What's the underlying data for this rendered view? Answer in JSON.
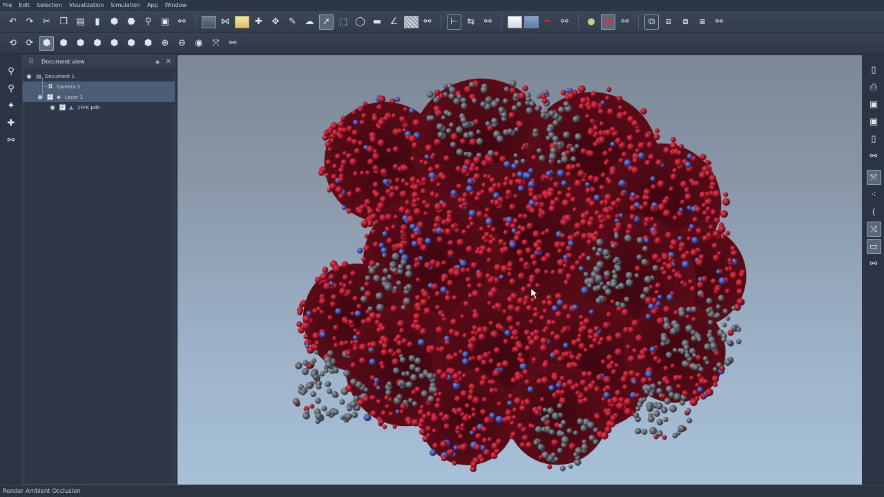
{
  "menu": [
    "File",
    "Edit",
    "Selection",
    "Visualization",
    "Simulation",
    "App",
    "Window"
  ],
  "toolbar1": {
    "group1": [
      "undo-icon",
      "redo-icon",
      "cut-icon",
      "copy-icon",
      "paste-icon",
      "delete-icon",
      "add-hexagon-icon",
      "remove-hexagon-icon",
      "zoom-icon",
      "frame-icon",
      "plugin-icon"
    ],
    "group2": [
      "dark-swatch",
      "bonds-icon",
      "highlight-swatch",
      "add-atom-icon",
      "move-icon",
      "eraser-icon",
      "lasso-icon",
      "select-arrow-icon",
      "select-box-icon",
      "circle-select-icon",
      "ruler-icon",
      "angle-icon",
      "grid-icon",
      "plugin-icon"
    ],
    "group3": [
      "tree-icon",
      "clone-icon",
      "plugin-icon"
    ],
    "group4": [
      "white-swatch",
      "blue-swatch",
      "red-marker-icon",
      "plugin-icon"
    ],
    "group5": [
      "point-icon",
      "target-icon",
      "plugin-icon"
    ],
    "group6": [
      "layout-1-icon",
      "layout-2-icon",
      "layout-3-icon",
      "layout-4-icon",
      "plugin-icon"
    ],
    "active": "select-arrow-icon"
  },
  "toolbar2": [
    "camera-reset-icon",
    "camera-orbit-icon",
    "view-front-icon",
    "view-back-icon",
    "view-left-icon",
    "view-right-icon",
    "view-top-icon",
    "view-bottom-icon",
    "view-iso-icon",
    "zoom-in-icon",
    "zoom-out-icon",
    "visibility-icon",
    "fit-icon",
    "plugin-icon"
  ],
  "left_toolbar": [
    "search-atoms-icon",
    "search-residues-icon",
    "magic-wand-icon",
    "add-structure-icon",
    "plugin-icon"
  ],
  "right_toolbar": [
    "new-document-icon",
    "print-icon",
    "save-icon",
    "save-as-icon",
    "export-icon",
    "plugin-icon",
    "network-icon",
    "nodes-icon",
    "curve-icon",
    "graph-icon",
    "panel-icon",
    "plugin-icon"
  ],
  "document_panel": {
    "title": "Document view",
    "items": [
      {
        "label": "Document 1",
        "icon": "document-icon",
        "level": 0,
        "checked": null,
        "selected": false
      },
      {
        "label": "Camera 1",
        "icon": "camera-icon",
        "level": 1,
        "checked": null,
        "selected": true
      },
      {
        "label": "Layer 1",
        "icon": "layer-icon",
        "level": 1,
        "checked": true,
        "selected": true
      },
      {
        "label": "1FFK.pdb",
        "icon": "molecule-icon",
        "level": 2,
        "checked": true,
        "selected": false
      }
    ]
  },
  "viewport": {
    "subject": "molecular-structure",
    "colors": {
      "background_top": "#7d8796",
      "background_bottom": "#a7c1d9",
      "red": "#b1192e",
      "dark_red": "#5a0c18",
      "blue": "#3a4fa8",
      "grey": "#5a5e66"
    }
  },
  "status": {
    "text": "Render Ambient Occlusion"
  }
}
